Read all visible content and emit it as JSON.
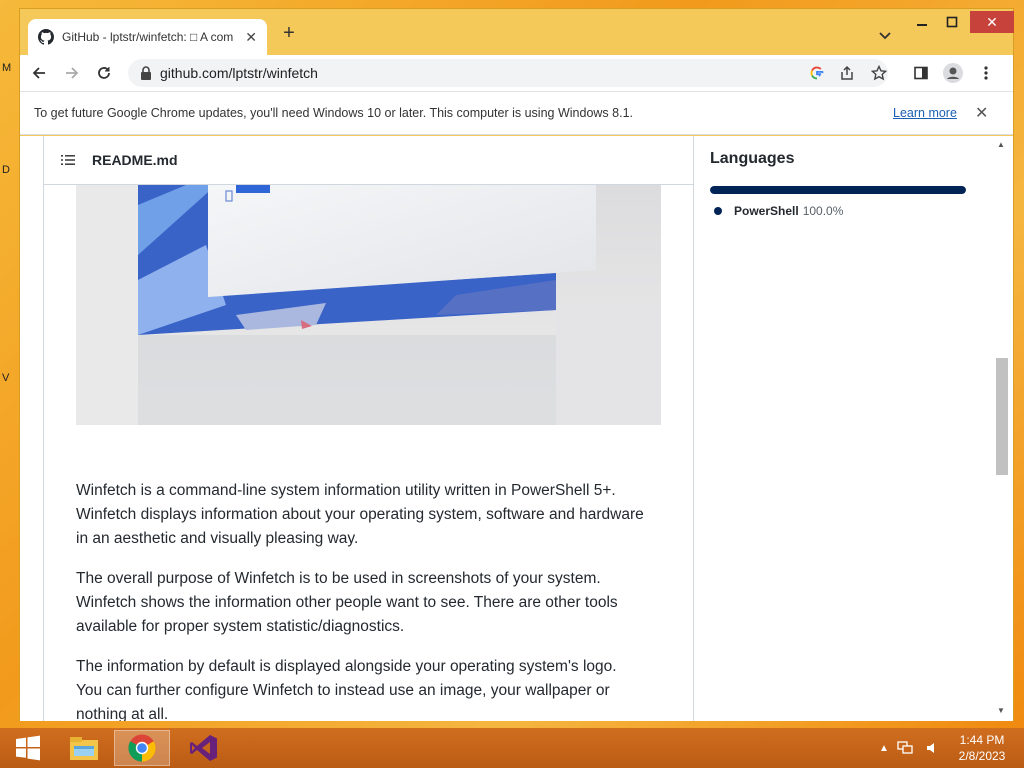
{
  "desktop": {
    "edge_letters": [
      "M",
      "D",
      "V"
    ]
  },
  "browser": {
    "tab": {
      "title": "GitHub - lptstr/winfetch: □ A com",
      "close": "✕"
    },
    "new_tab": "+",
    "window_controls": {
      "close": "✕"
    },
    "address": {
      "url": "github.com/lptstr/winfetch"
    },
    "infobar": {
      "message": "To get future Google Chrome updates, you'll need Windows 10 or later. This computer is using Windows 8.1.",
      "learn_more": "Learn more",
      "close": "✕"
    }
  },
  "readme": {
    "header_title": "README.md",
    "paragraphs": [
      "Winfetch is a command-line system information utility written in PowerShell 5+. Winfetch displays information about your operating system, software and hardware in an aesthetic and visually pleasing way.",
      "The overall purpose of Winfetch is to be used in screenshots of your system. Winfetch shows the information other people want to see. There are other tools available for proper system statistic/diagnostics.",
      "The information by default is displayed alongside your operating system's logo. You can further configure Winfetch to instead use an image, your wallpaper or nothing at all."
    ]
  },
  "sidebar": {
    "languages_title": "Languages",
    "languages": [
      {
        "name": "PowerShell",
        "percent": "100.0%",
        "fraction": 1.0,
        "color": "#012456"
      }
    ]
  },
  "taskbar": {
    "time": "1:44 PM",
    "date": "2/8/2023",
    "apps": [
      "start-icon",
      "file-explorer-icon",
      "chrome-icon",
      "visual-studio-icon"
    ]
  },
  "colors": {
    "accent_orange": "#f29a1c",
    "close_red": "#c7423b",
    "link_blue": "#1a5fb4",
    "powershell": "#012456"
  }
}
